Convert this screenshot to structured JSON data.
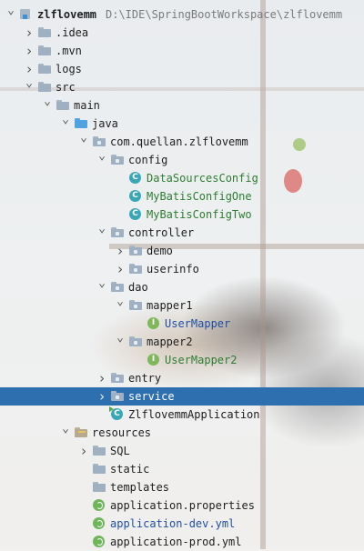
{
  "project": {
    "name": "zlflovemm",
    "path": "D:\\IDE\\SpringBootWorkspace\\zlflovemm"
  },
  "tree": [
    {
      "label": "zlflovemm",
      "path": "D:\\IDE\\SpringBootWorkspace\\zlflovemm",
      "depth": 0,
      "arrow": "down",
      "icon": "module-icon",
      "style": "bold"
    },
    {
      "label": ".idea",
      "depth": 1,
      "arrow": "right",
      "icon": "folder-icon"
    },
    {
      "label": ".mvn",
      "depth": 1,
      "arrow": "right",
      "icon": "folder-icon"
    },
    {
      "label": "logs",
      "depth": 1,
      "arrow": "right",
      "icon": "folder-icon"
    },
    {
      "label": "src",
      "depth": 1,
      "arrow": "down",
      "icon": "folder-icon"
    },
    {
      "label": "main",
      "depth": 2,
      "arrow": "down",
      "icon": "folder-icon"
    },
    {
      "label": "java",
      "depth": 3,
      "arrow": "down",
      "icon": "source-folder-icon"
    },
    {
      "label": "com.quellan.zlflovemm",
      "depth": 4,
      "arrow": "down",
      "icon": "package-icon"
    },
    {
      "label": "config",
      "depth": 5,
      "arrow": "down",
      "icon": "package-icon"
    },
    {
      "label": "DataSourcesConfig",
      "depth": 6,
      "arrow": "none",
      "icon": "class-icon",
      "style": "green"
    },
    {
      "label": "MyBatisConfigOne",
      "depth": 6,
      "arrow": "none",
      "icon": "class-icon",
      "style": "green"
    },
    {
      "label": "MyBatisConfigTwo",
      "depth": 6,
      "arrow": "none",
      "icon": "class-icon",
      "style": "green"
    },
    {
      "label": "controller",
      "depth": 5,
      "arrow": "down",
      "icon": "package-icon"
    },
    {
      "label": "demo",
      "depth": 6,
      "arrow": "right",
      "icon": "package-icon"
    },
    {
      "label": "userinfo",
      "depth": 6,
      "arrow": "right",
      "icon": "package-icon"
    },
    {
      "label": "dao",
      "depth": 5,
      "arrow": "down",
      "icon": "package-icon"
    },
    {
      "label": "mapper1",
      "depth": 6,
      "arrow": "down",
      "icon": "package-icon"
    },
    {
      "label": "UserMapper",
      "depth": 7,
      "arrow": "none",
      "icon": "interface-icon",
      "style": "blue"
    },
    {
      "label": "mapper2",
      "depth": 6,
      "arrow": "down",
      "icon": "package-icon"
    },
    {
      "label": "UserMapper2",
      "depth": 7,
      "arrow": "none",
      "icon": "interface-icon",
      "style": "green"
    },
    {
      "label": "entry",
      "depth": 5,
      "arrow": "right",
      "icon": "package-icon"
    },
    {
      "label": "service",
      "depth": 5,
      "arrow": "right",
      "icon": "package-icon",
      "selected": true
    },
    {
      "label": "ZlflovemmApplication",
      "depth": 5,
      "arrow": "none",
      "icon": "application-class-icon"
    },
    {
      "label": "resources",
      "depth": 3,
      "arrow": "down",
      "icon": "resources-folder-icon"
    },
    {
      "label": "SQL",
      "depth": 4,
      "arrow": "right",
      "icon": "folder-icon"
    },
    {
      "label": "static",
      "depth": 4,
      "arrow": "none",
      "icon": "folder-icon"
    },
    {
      "label": "templates",
      "depth": 4,
      "arrow": "none",
      "icon": "folder-icon"
    },
    {
      "label": "application.properties",
      "depth": 4,
      "arrow": "none",
      "icon": "spring-config-icon"
    },
    {
      "label": "application-dev.yml",
      "depth": 4,
      "arrow": "none",
      "icon": "spring-config-icon",
      "style": "blue"
    },
    {
      "label": "application-prod.yml",
      "depth": 4,
      "arrow": "none",
      "icon": "spring-config-icon"
    }
  ],
  "colors": {
    "selection": "#2e6fb0",
    "text": "#1e1e1e",
    "modified_blue": "#1f4fa3",
    "new_green": "#2e7d32",
    "path_gray": "#7a7a7a"
  }
}
